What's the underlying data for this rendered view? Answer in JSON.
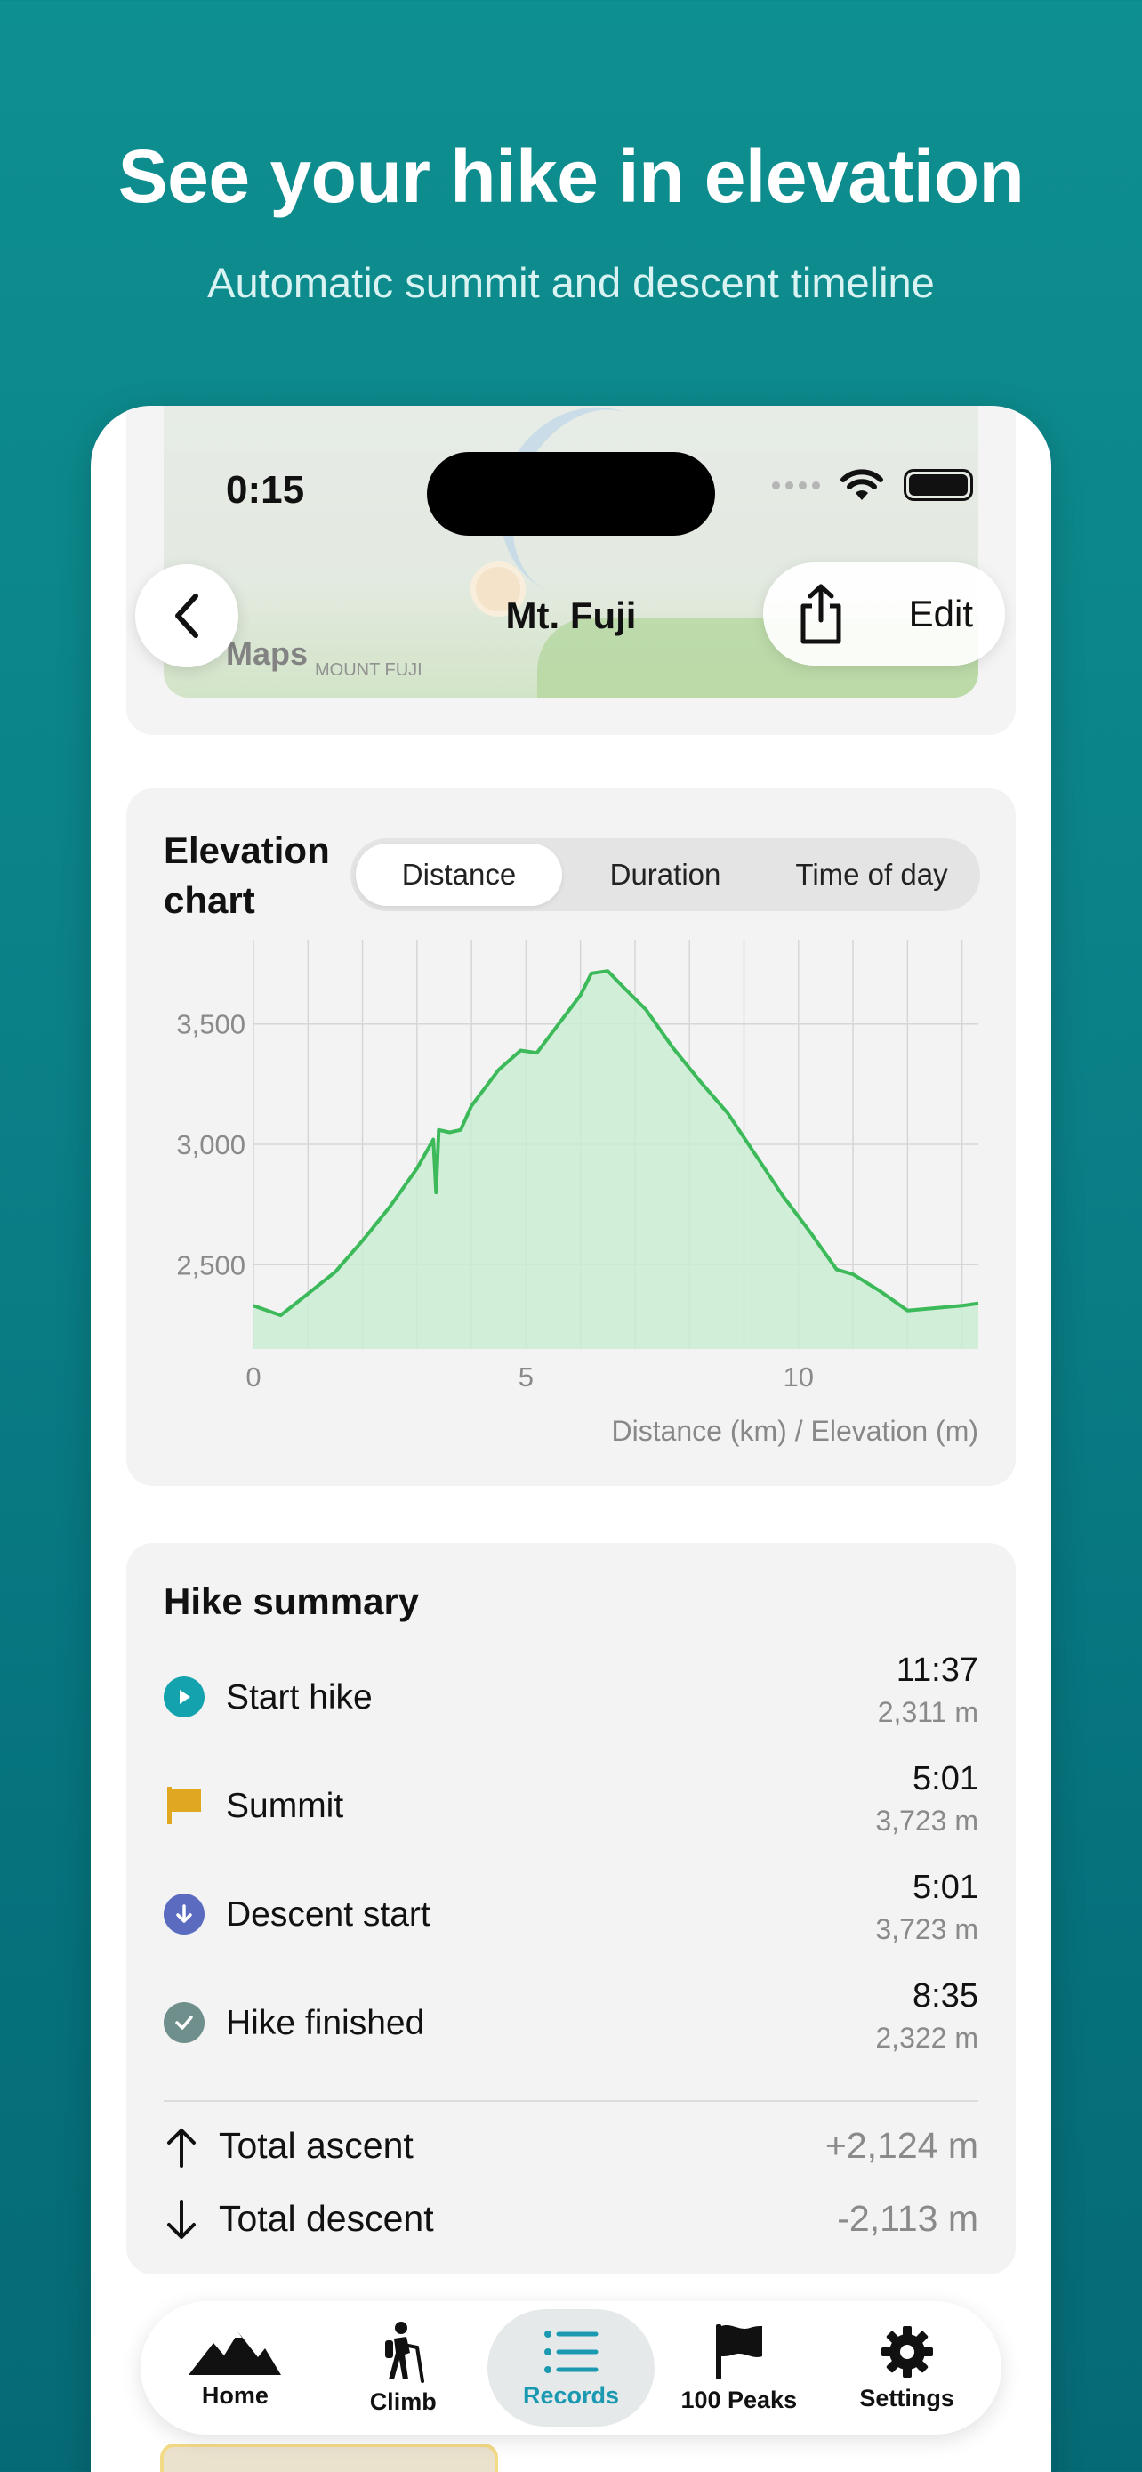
{
  "hero": {
    "title": "See your hike in elevation",
    "subtitle": "Automatic summit and descent timeline"
  },
  "status_bar": {
    "time": "0:15",
    "icons": [
      "signal-dots-icon",
      "wifi-icon",
      "battery-icon"
    ]
  },
  "map": {
    "logo_text": "Maps",
    "place_label": "MOUNT FUJI"
  },
  "nav": {
    "title": "Mt. Fuji",
    "back_icon": "chevron-left-icon",
    "share_icon": "share-icon",
    "edit_label": "Edit"
  },
  "elevation": {
    "title": "Elevation chart",
    "tabs": [
      "Distance",
      "Duration",
      "Time of day"
    ],
    "active_tab": "Distance",
    "footer": "Distance (km)  /  Elevation (m)"
  },
  "chart_data": {
    "type": "area",
    "title": "",
    "xlabel": "Distance (km)",
    "ylabel": "Elevation (m)",
    "xlim": [
      0,
      13.3
    ],
    "ylim": [
      2150,
      3850
    ],
    "x_ticks": [
      0,
      5,
      10
    ],
    "y_ticks": [
      2500,
      3000,
      3500
    ],
    "y_tick_labels": [
      "2,500",
      "3,000",
      "3,500"
    ],
    "grid": true,
    "color": "#3cba5a",
    "fill": "#c9ecd2",
    "series": [
      {
        "x": [
          0,
          0.5,
          1.0,
          1.5,
          2.0,
          2.5,
          3.0,
          3.3,
          3.35,
          3.4,
          3.6,
          3.8,
          4.0,
          4.5,
          4.9,
          5.2,
          5.5,
          5.8,
          6.0,
          6.2,
          6.5,
          6.8,
          7.2,
          7.7,
          8.2,
          8.7,
          9.2,
          9.7,
          10.2,
          10.7,
          11.0,
          11.5,
          12.0,
          12.5,
          13.0,
          13.3
        ],
        "y": [
          2330,
          2290,
          2380,
          2470,
          2600,
          2740,
          2900,
          3020,
          2800,
          3060,
          3050,
          3060,
          3160,
          3310,
          3390,
          3380,
          3470,
          3560,
          3620,
          3710,
          3720,
          3650,
          3560,
          3400,
          3260,
          3130,
          2960,
          2790,
          2640,
          2480,
          2460,
          2390,
          2310,
          2320,
          2330,
          2340
        ]
      }
    ]
  },
  "summary": {
    "title": "Hike summary",
    "events": [
      {
        "icon": "play-icon",
        "color": "#14a3ae",
        "label": "Start hike",
        "time": "11:37",
        "elevation": "2,311 m"
      },
      {
        "icon": "flag-icon",
        "color": "#e0a820",
        "label": "Summit",
        "time": "5:01",
        "elevation": "3,723 m"
      },
      {
        "icon": "arrow-down-circle-icon",
        "color": "#5b6bc0",
        "label": "Descent start",
        "time": "5:01",
        "elevation": "3,723 m"
      },
      {
        "icon": "check-circle-icon",
        "color": "#6f8f8c",
        "label": "Hike finished",
        "time": "8:35",
        "elevation": "2,322 m"
      }
    ],
    "totals": [
      {
        "icon": "arrow-up-icon",
        "label": "Total ascent",
        "value": "+2,124 m"
      },
      {
        "icon": "arrow-down-icon",
        "label": "Total descent",
        "value": "-2,113 m"
      }
    ]
  },
  "tabbar": {
    "items": [
      {
        "icon": "mountains-icon",
        "label": "Home"
      },
      {
        "icon": "hiker-icon",
        "label": "Climb"
      },
      {
        "icon": "list-icon",
        "label": "Records"
      },
      {
        "icon": "flag-icon",
        "label": "100 Peaks"
      },
      {
        "icon": "gear-icon",
        "label": "Settings"
      }
    ],
    "active": "Records",
    "active_color": "#1a99b0"
  }
}
